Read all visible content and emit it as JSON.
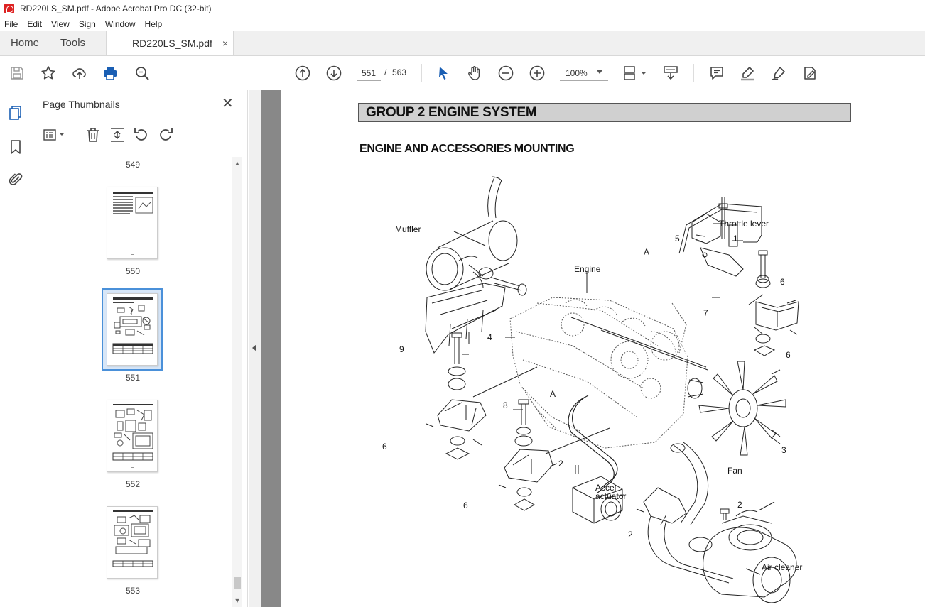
{
  "window": {
    "title": "RD220LS_SM.pdf - Adobe Acrobat Pro DC (32-bit)"
  },
  "menu": {
    "items": [
      "File",
      "Edit",
      "View",
      "Sign",
      "Window",
      "Help"
    ]
  },
  "tabs": {
    "home": "Home",
    "tools": "Tools",
    "document": "RD220LS_SM.pdf",
    "close_glyph": "×"
  },
  "toolbar": {
    "current_page": "551",
    "page_separator": "/",
    "total_pages": "563",
    "zoom": "100%"
  },
  "thumbnails": {
    "title": "Page Thumbnails",
    "close_glyph": "✕",
    "pages": [
      {
        "label": "549"
      },
      {
        "label": "550"
      },
      {
        "label": "551",
        "selected": true
      },
      {
        "label": "552"
      },
      {
        "label": "553"
      }
    ]
  },
  "document": {
    "group_header": "GROUP  2  ENGINE SYSTEM",
    "section_title": "ENGINE AND ACCESSORIES MOUNTING",
    "callouts": {
      "muffler": "Muffler",
      "throttle_lever": "Throttle lever",
      "engine": "Engine",
      "fan": "Fan",
      "accel_actuator_1": "Accel",
      "accel_actuator_2": "actuator",
      "air_cleaner": "Air cleaner",
      "n1": "1",
      "n2a": "2",
      "n2b": "2",
      "n2c": "2",
      "n3": "3",
      "n4": "4",
      "n5": "5",
      "n6a": "6",
      "n6b": "6",
      "n6c": "6",
      "n6d": "6",
      "n7": "7",
      "n8": "8",
      "n9": "9",
      "a1": "A",
      "a2": "A"
    }
  },
  "colors": {
    "accent_blue": "#1a5fb4",
    "selected_thumb": "#4a90d9",
    "header_gray": "#d0d0d0"
  }
}
